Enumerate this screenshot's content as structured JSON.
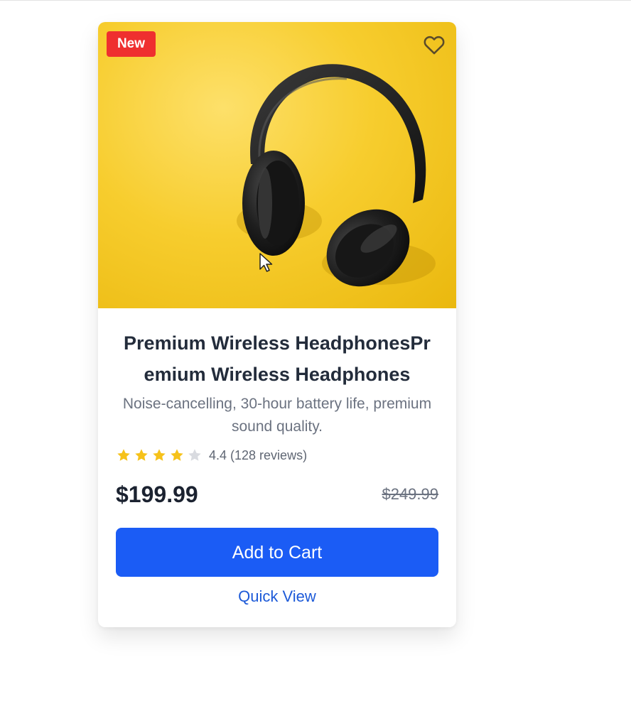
{
  "product": {
    "badge": "New",
    "title": "Premium Wireless HeadphonesPremium Wireless Headphones",
    "description": "Noise-cancelling, 30-hour battery life, premium sound quality.",
    "rating": {
      "value": 4.4,
      "max": 5,
      "text": "4.4 (128 reviews)",
      "filled_stars": 4
    },
    "price": "$199.99",
    "original_price": "$249.99",
    "add_to_cart_label": "Add to Cart",
    "quick_view_label": "Quick View",
    "image_alt": "Black over-ear headphones on yellow background"
  },
  "icons": {
    "wishlist": "heart-outline-icon",
    "star_filled": "star-filled-icon",
    "star_empty": "star-empty-icon",
    "cursor": "mouse-pointer-icon"
  },
  "colors": {
    "badge_bg": "#ef2f2f",
    "button_bg": "#1b5cf5",
    "link": "#1d5ad8",
    "star_filled": "#f6c21a",
    "star_empty": "#d9dbe0",
    "image_bg": "#f7cd2e"
  }
}
